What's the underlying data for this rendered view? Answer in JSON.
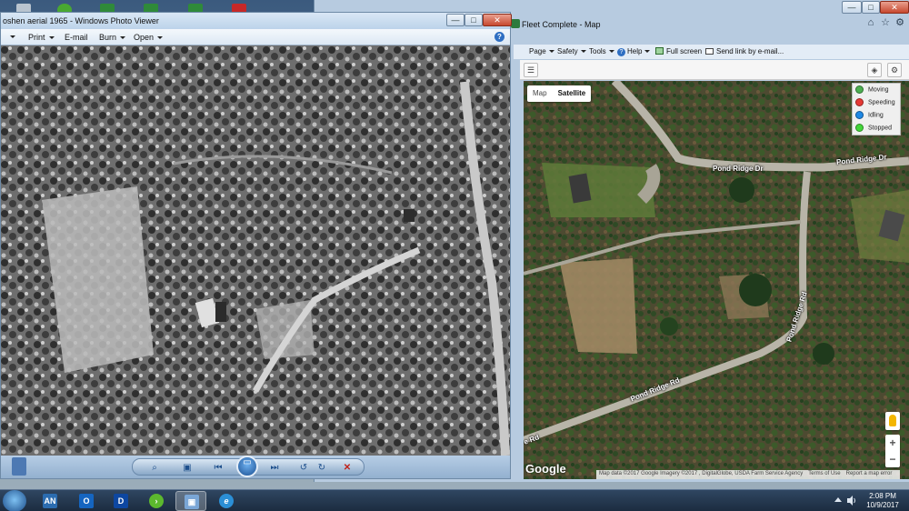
{
  "photo_viewer": {
    "title": "oshen aerial 1965 - Windows Photo Viewer",
    "window_buttons": {
      "minimize": "—",
      "maximize": "□",
      "close": "✕"
    },
    "menu": [
      "Print",
      "E-mail",
      "Burn",
      "Open"
    ],
    "first_menu_caret": true,
    "help": "?",
    "controls": [
      {
        "name": "zoom-icon",
        "glyph": "⌕"
      },
      {
        "name": "actual-size-icon",
        "glyph": "▣"
      },
      {
        "name": "previous-icon",
        "glyph": "⏮"
      },
      {
        "name": "slideshow-icon",
        "glyph": "▭"
      },
      {
        "name": "next-icon",
        "glyph": "⏭"
      },
      {
        "name": "rotate-left-icon",
        "glyph": "↺"
      },
      {
        "name": "rotate-right-icon",
        "glyph": "↻"
      },
      {
        "name": "delete-icon",
        "glyph": "✕"
      }
    ]
  },
  "browser": {
    "tab_title": "Fleet Complete - Map",
    "command_bar": [
      {
        "label": "Page",
        "has_caret": true
      },
      {
        "label": "Safety",
        "has_caret": true
      },
      {
        "label": "Tools",
        "has_caret": true
      },
      {
        "label": "Help",
        "has_caret": true,
        "icon": "help-icon"
      },
      {
        "label": "Full screen",
        "icon": "full-screen-icon"
      },
      {
        "label": "Send link by e-mail...",
        "icon": "mail-icon"
      }
    ]
  },
  "map": {
    "map_type": {
      "map": "Map",
      "satellite": "Satellite",
      "selected": "Satellite"
    },
    "legend": [
      {
        "label": "Moving",
        "color": "#4caf50"
      },
      {
        "label": "Speeding",
        "color": "#e53935"
      },
      {
        "label": "Idling",
        "color": "#1e88e5"
      },
      {
        "label": "Stopped",
        "color": "#43d63a"
      }
    ],
    "roads": {
      "pond_ridge_dr_1": "Pond Ridge Dr",
      "pond_ridge_dr_2": "Pond Ridge Dr",
      "pond_ridge_rd_1": "Pond Ridge Rd",
      "pond_ridge_rd_2": "Pond Ridge Rd",
      "edge_label": "e Rd"
    },
    "google": "Google",
    "attribution": "Map data ©2017 Google Imagery ©2017 , DigitalGlobe, USDA Farm Service Agency",
    "terms": "Terms of Use",
    "report": "Report a map error",
    "zoom_in": "+",
    "zoom_out": "−"
  },
  "taskbar": {
    "items": [
      {
        "name": "taskbar-an-app",
        "glyph": "AN",
        "color": "#2b6cb0",
        "active": false
      },
      {
        "name": "taskbar-outlook",
        "glyph": "O",
        "color": "#1565c0",
        "active": false
      },
      {
        "name": "taskbar-d-app",
        "glyph": "D",
        "color": "#0d47a1",
        "active": false
      },
      {
        "name": "taskbar-play-app",
        "glyph": "›",
        "color": "#5cb82e",
        "active": false
      },
      {
        "name": "taskbar-photo-viewer",
        "glyph": "▣",
        "color": "#7aa6d6",
        "active": true
      },
      {
        "name": "taskbar-internet-explorer",
        "glyph": "e",
        "color": "#2b8fd6",
        "active": false
      }
    ],
    "clock_time": "2:08 PM",
    "clock_date": "10/9/2017"
  }
}
